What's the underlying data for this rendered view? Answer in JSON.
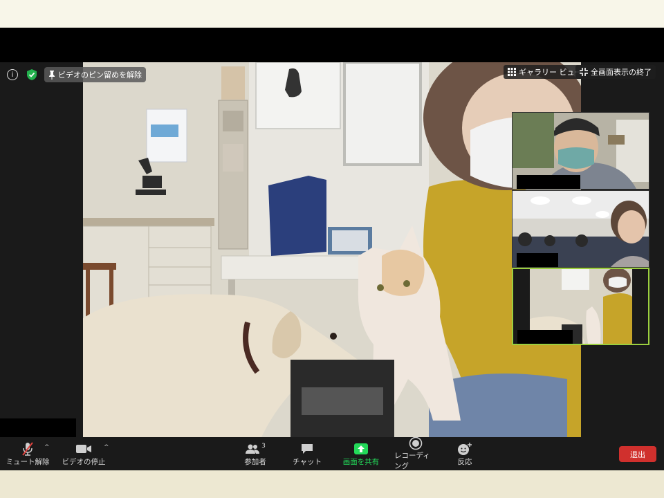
{
  "overlay": {
    "unpin_label": "ビデオのピン留めを解除",
    "gallery_label": "ギャラリー ビュー",
    "exit_fullscreen_label": "全画面表示の終了",
    "info_glyph": "i"
  },
  "toolbar": {
    "mute_label": "ミュート解除",
    "video_label": "ビデオの停止",
    "participants_label": "参加者",
    "participants_count": "3",
    "chat_label": "チャット",
    "share_label": "画面を共有",
    "record_label": "レコーディング",
    "reactions_label": "反応",
    "leave_label": "退出"
  },
  "colors": {
    "share_green": "#23d959",
    "leave_red": "#d0302d",
    "active_border": "#9bcf3f",
    "mute_slash": "#e0433f"
  },
  "icons": {
    "info": "info-icon",
    "encryption": "shield-check-icon",
    "pin": "pin-icon",
    "gallery": "grid-icon",
    "exit_fullscreen": "compress-icon",
    "mute": "microphone-slash-icon",
    "video": "video-camera-icon",
    "participants": "people-icon",
    "chat": "speech-bubble-icon",
    "share": "share-up-arrow-icon",
    "record": "record-icon",
    "reactions": "smiley-plus-icon"
  }
}
